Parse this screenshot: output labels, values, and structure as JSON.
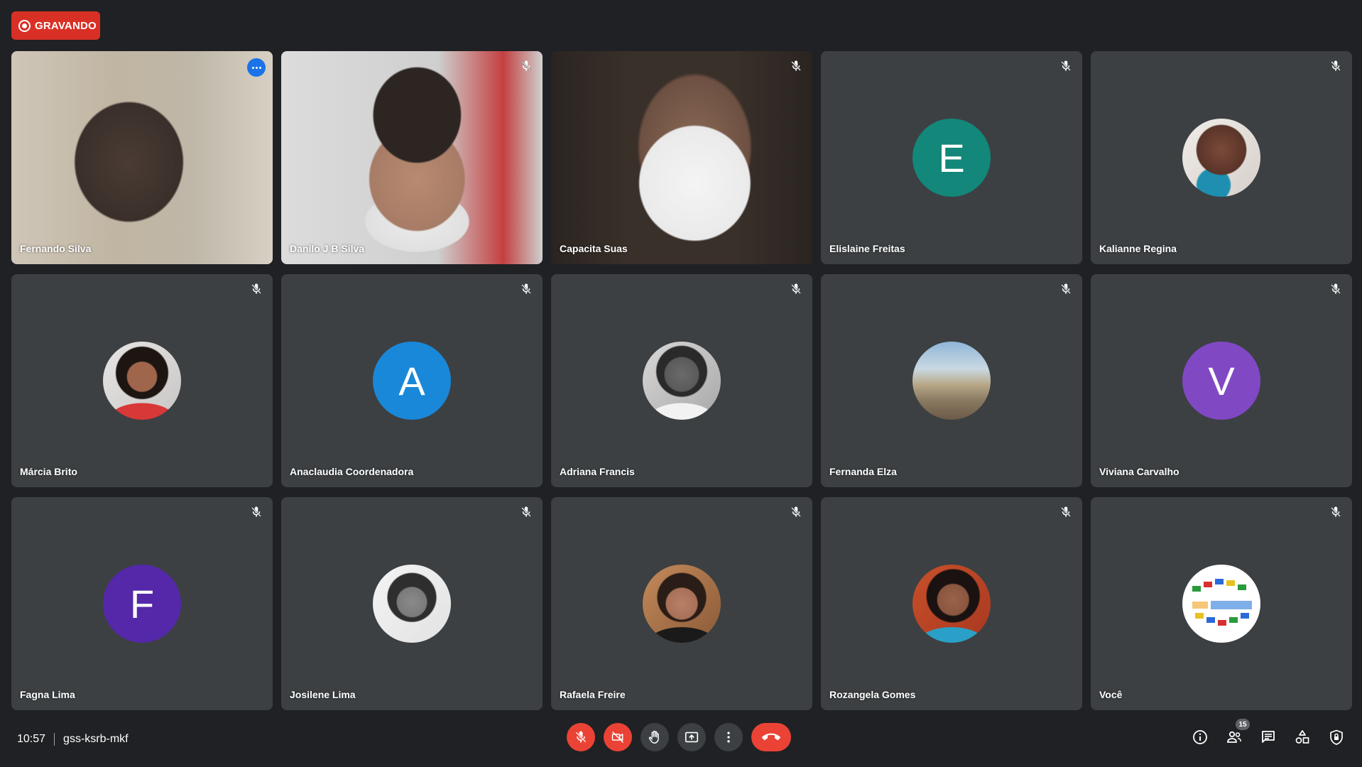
{
  "recording": {
    "label": "GRAVANDO"
  },
  "participants": [
    {
      "name": "Fernando Silva",
      "type": "video"
    },
    {
      "name": "Danilo J B Silva",
      "type": "video"
    },
    {
      "name": "Capacita Suas",
      "type": "video"
    },
    {
      "name": "Elislaine Freitas",
      "type": "letter",
      "initial": "E",
      "color": "#12877a"
    },
    {
      "name": "Kalianne Regina",
      "type": "photo"
    },
    {
      "name": "Márcia Brito",
      "type": "photo"
    },
    {
      "name": "Anaclaudia Coordenadora",
      "type": "letter",
      "initial": "A",
      "color": "#1a88d8"
    },
    {
      "name": "Adriana Francis",
      "type": "photo"
    },
    {
      "name": "Fernanda Elza",
      "type": "photo"
    },
    {
      "name": "Viviana Carvalho",
      "type": "letter",
      "initial": "V",
      "color": "#8148c4"
    },
    {
      "name": "Fagna Lima",
      "type": "letter",
      "initial": "F",
      "color": "#5428a8"
    },
    {
      "name": "Josilene Lima",
      "type": "photo"
    },
    {
      "name": "Rafaela Freire",
      "type": "photo"
    },
    {
      "name": "Rozangela Gomes",
      "type": "photo"
    },
    {
      "name": "Você",
      "type": "photo"
    }
  ],
  "footer": {
    "time": "10:57",
    "meeting_code": "gss-ksrb-mkf",
    "participant_count": "15"
  },
  "icons": {
    "mute": "mic-off-icon",
    "cam": "camera-off-icon",
    "hand": "raise-hand-icon",
    "present": "present-screen-icon",
    "more": "more-options-icon",
    "end": "end-call-icon",
    "info": "info-icon",
    "people": "people-icon",
    "chat": "chat-icon",
    "activities": "activities-icon",
    "safety": "host-controls-icon"
  }
}
